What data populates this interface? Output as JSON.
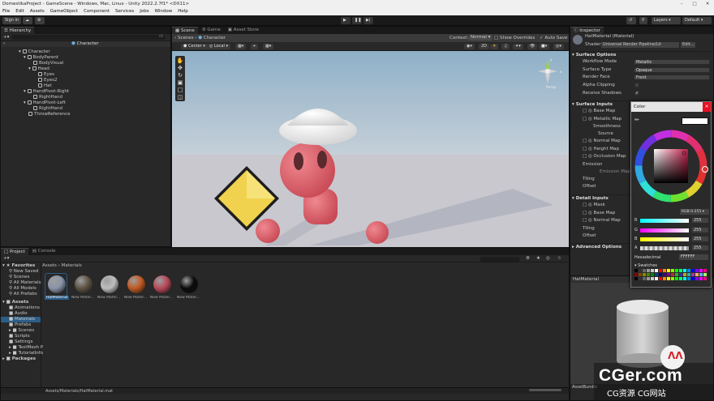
{
  "window": {
    "title": "DomestikaProject - GameScene - Windows, Mac, Linux - Unity 2022.2.7f1* <DX11>"
  },
  "menu": [
    "File",
    "Edit",
    "Assets",
    "GameObject",
    "Component",
    "Services",
    "Jobs",
    "Window",
    "Help"
  ],
  "toolbar": {
    "signin": "Sign in",
    "layers": "Layers",
    "layout": "Default"
  },
  "hierarchy": {
    "tab": "Hierarchy",
    "search_placeholder": "All",
    "scene": "Character",
    "items": [
      "Character",
      "BodyParent",
      "BodyVisual",
      "Head",
      "Eyes",
      "Eyes2",
      "Hat",
      "HandPivot-Right",
      "RightHand",
      "HandPivot-Left",
      "RightHand",
      "ThrowReference"
    ]
  },
  "scene": {
    "tabs": [
      "Scene",
      "Game",
      "Asset Store"
    ],
    "breadcrumb": [
      "Scenes",
      "Character"
    ],
    "context_label": "Context:",
    "context_value": "Normal",
    "show_overrides": "Show Overrides",
    "auto_save": "Auto Save",
    "pivot": "Center",
    "space": "Local",
    "view_mode": "2D",
    "gizmo_label": "Persp",
    "axis_y": "y",
    "axis_x": "x"
  },
  "project": {
    "tabs": [
      "Project",
      "Console"
    ],
    "favorites_label": "Favorites",
    "favorites": [
      "New Saved",
      "Scenes",
      "All Materials",
      "All Models",
      "All Prefabs"
    ],
    "assets_label": "Assets",
    "folders": [
      "Animations",
      "Audio",
      "Materials",
      "Prefabs",
      "Scenes",
      "Scripts",
      "Settings",
      "TextMesh P",
      "TutorialInfo"
    ],
    "packages_label": "Packages",
    "breadcrumb": [
      "Assets",
      "Materials"
    ],
    "materials": [
      {
        "name": "HatMaterial",
        "color": "#8a94a8"
      },
      {
        "name": "New Mater...",
        "color": "#5e5244"
      },
      {
        "name": "New Mater...",
        "color": "#bdbdbd"
      },
      {
        "name": "New Mater...",
        "color": "#c25a22"
      },
      {
        "name": "New Mater...",
        "color": "#b8485a"
      },
      {
        "name": "New Mater...",
        "color": "#0b0b0b"
      }
    ],
    "status_path": "Assets/Materials/HatMaterial.mat"
  },
  "inspector": {
    "tab": "Inspector",
    "material_name": "HatMaterial (Material)",
    "shader_label": "Shader",
    "shader_value": "Universal Render Pipeline/Lit",
    "edit_label": "Edit...",
    "surface_options": "Surface Options",
    "workflow_label": "Workflow Mode",
    "workflow_value": "Metallic",
    "surface_type_label": "Surface Type",
    "surface_type_value": "Opaque",
    "render_face_label": "Render Face",
    "render_face_value": "Front",
    "alpha_clipping": "Alpha Clipping",
    "receive_shadows": "Receive Shadows",
    "surface_inputs": "Surface Inputs",
    "base_map": "Base Map",
    "metallic_map": "Metallic Map",
    "smoothness": "Smoothness",
    "source": "Source",
    "normal_map": "Normal Map",
    "height_map": "Height Map",
    "occlusion_map": "Occlusion Map",
    "emission": "Emission",
    "emission_map": "Emission Map",
    "tiling": "Tiling",
    "offset": "Offset",
    "detail_inputs": "Detail Inputs",
    "mask": "Mask",
    "detail_base_map": "Base Map",
    "detail_normal_map": "Normal Map",
    "detail_tiling": "Tiling",
    "detail_offset": "Offset",
    "advanced_options": "Advanced Options",
    "preview_title": "HatMaterial",
    "asset_bundle": "AssetBundle"
  },
  "color_picker": {
    "title": "Color",
    "mode": "RGB 0-255",
    "channels": [
      {
        "label": "R",
        "value": "255"
      },
      {
        "label": "G",
        "value": "255"
      },
      {
        "label": "B",
        "value": "255"
      },
      {
        "label": "A",
        "value": "255"
      }
    ],
    "hex_label": "Hexadecimal",
    "hex_value": "FFFFFF",
    "swatches_label": "Swatches"
  },
  "watermark": {
    "main": "CGer.com",
    "sub": "CG资源 CG网站"
  },
  "colors": {
    "accent": "#2c5d87",
    "sky": "#a4b9c8",
    "ground": "#c6c6ca",
    "character": "#e06068",
    "hat": "#efefef",
    "diamond": "#f2d24a"
  }
}
